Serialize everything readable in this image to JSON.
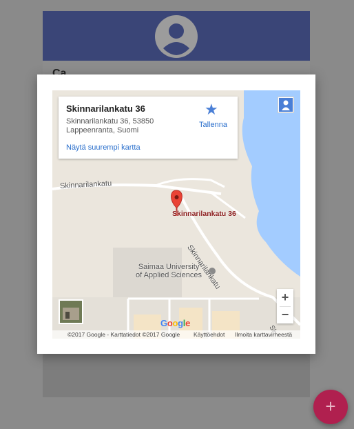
{
  "background": {
    "card_title_partial": "Ca…",
    "avatar_icon": "account-circle-icon"
  },
  "map_card": {
    "info": {
      "title": "Skinnarilankatu 36",
      "address_line1": "Skinnarilankatu 36, 53850",
      "address_line2": "Lappeenranta, Suomi",
      "larger_map_link": "Näytä suurempi kartta",
      "save_label": "Tallenna",
      "save_icon": "star-icon"
    },
    "marker_label": "Skinnarilankatu 36",
    "streets": [
      "Skinnarilankatu",
      "Skinnarilankatu",
      "Sk"
    ],
    "poi": "Saimaa University\nof Applied Sciences",
    "zoom_in": "+",
    "zoom_out": "−",
    "google_logo": [
      "G",
      "o",
      "o",
      "g",
      "l",
      "e"
    ],
    "footer": {
      "copyright": "©2017 Google - Karttatiedot ©2017 Google",
      "terms": "Käyttöehdot",
      "report": "Ilmoita karttavirheestä"
    }
  },
  "fab": {
    "label": "+",
    "icon": "add-icon"
  },
  "colors": {
    "header": "#3a4577",
    "fab": "#b0204f",
    "water": "#a3ccff",
    "link": "#2a6fcc",
    "marker": "#ea4335"
  }
}
